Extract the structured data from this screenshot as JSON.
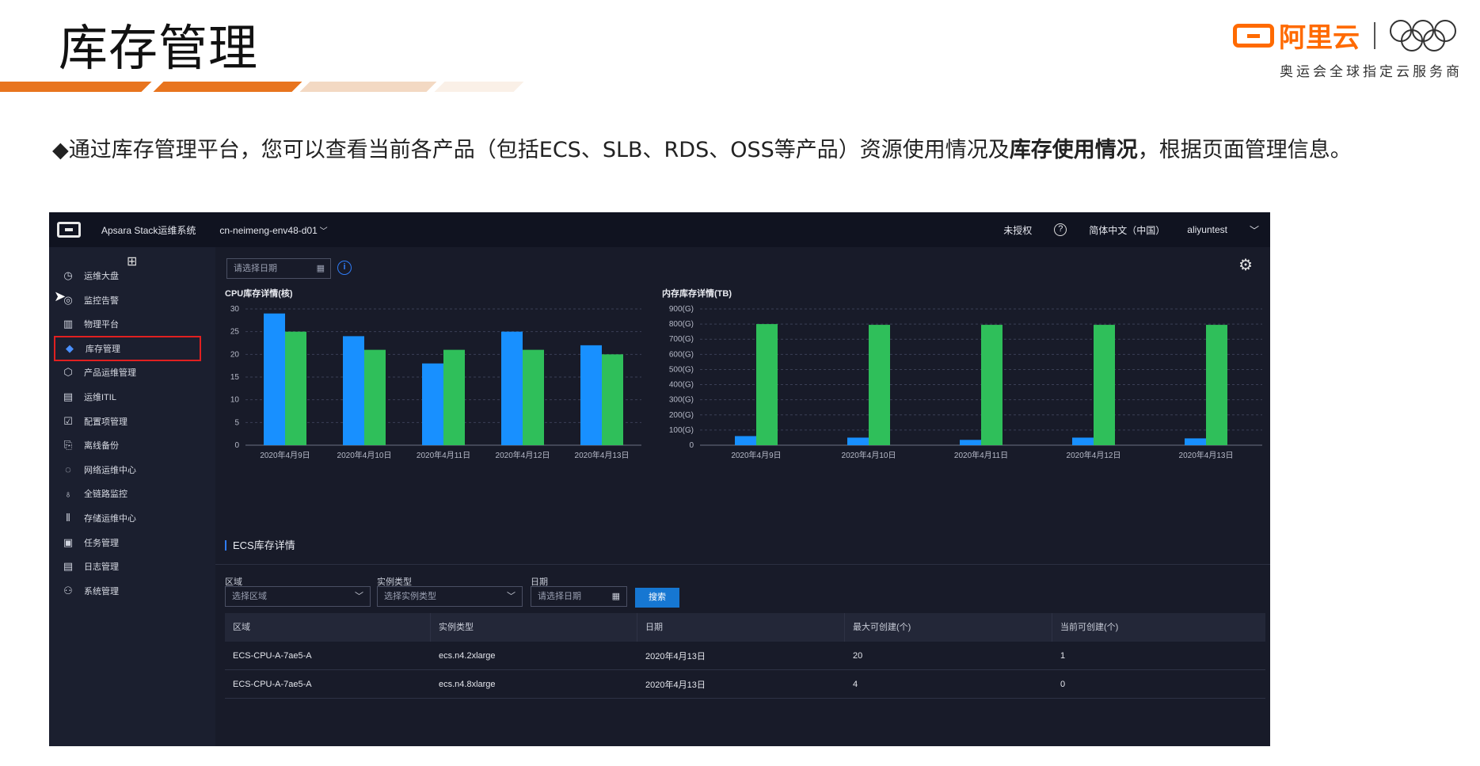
{
  "slide": {
    "title": "库存管理",
    "brand_name": "阿里云",
    "brand_sub": "奥运会全球指定云服务商",
    "bullet_prefix": "◆通过库存管理平台，您可以查看当前各产品（包括ECS、SLB、RDS、OSS等产品）资源使用情况及",
    "bullet_bold": "库存使用情况",
    "bullet_suffix": "，根据页面管理信息。"
  },
  "topbar": {
    "system_name": "Apsara Stack运维系统",
    "environment": "cn-neimeng-env48-d01",
    "unauthorized": "未授权",
    "help_icon": "?",
    "language": "简体中文（中国）",
    "user": "aliyuntest"
  },
  "sidebar": {
    "items": [
      {
        "label": "运维大盘",
        "icon": "pie-chart-icon",
        "glyph": "◷"
      },
      {
        "label": "监控告警",
        "icon": "alarm-icon",
        "glyph": "◎"
      },
      {
        "label": "物理平台",
        "icon": "bar-chart-icon",
        "glyph": "▥"
      },
      {
        "label": "库存管理",
        "icon": "stack-icon",
        "glyph": "◆"
      },
      {
        "label": "产品运维管理",
        "icon": "cube-icon",
        "glyph": "⬡"
      },
      {
        "label": "运维ITIL",
        "icon": "ticket-icon",
        "glyph": "▤"
      },
      {
        "label": "配置项管理",
        "icon": "checkbox-icon",
        "glyph": "☑"
      },
      {
        "label": "离线备份",
        "icon": "backup-icon",
        "glyph": "⎘"
      },
      {
        "label": "网络运维中心",
        "icon": "network-icon",
        "glyph": "◌"
      },
      {
        "label": "全链路监控",
        "icon": "topology-icon",
        "glyph": "♁"
      },
      {
        "label": "存储运维中心",
        "icon": "storage-icon",
        "glyph": "⦀"
      },
      {
        "label": "任务管理",
        "icon": "task-icon",
        "glyph": "▣"
      },
      {
        "label": "日志管理",
        "icon": "log-icon",
        "glyph": "▤"
      },
      {
        "label": "系统管理",
        "icon": "user-settings-icon",
        "glyph": "⚇"
      }
    ],
    "active_index": 3
  },
  "toolbar": {
    "date_placeholder": "请选择日期",
    "info_icon": "i"
  },
  "colors": {
    "series_blue": "#1890ff",
    "series_green": "#2fbf5a",
    "accent": "#1677d2",
    "highlight_box": "#e02020"
  },
  "chart_data": [
    {
      "type": "bar",
      "title": "CPU库存详情(核)",
      "categories": [
        "2020年4月9日",
        "2020年4月10日",
        "2020年4月11日",
        "2020年4月12日",
        "2020年4月13日"
      ],
      "series": [
        {
          "values": [
            29,
            24,
            18,
            25,
            22
          ]
        },
        {
          "values": [
            25,
            21,
            21,
            21,
            20
          ]
        }
      ],
      "ylim": [
        0,
        30
      ],
      "yticks": [
        "0",
        "5",
        "10",
        "15",
        "20",
        "25",
        "30"
      ],
      "grid": true
    },
    {
      "type": "bar",
      "title": "内存库存详情(TB)",
      "categories": [
        "2020年4月9日",
        "2020年4月10日",
        "2020年4月11日",
        "2020年4月12日",
        "2020年4月13日"
      ],
      "series": [
        {
          "values": [
            60,
            50,
            35,
            50,
            45
          ]
        },
        {
          "values": [
            800,
            795,
            795,
            795,
            795
          ]
        }
      ],
      "ylim": [
        0,
        900
      ],
      "yticks": [
        "0",
        "100(G)",
        "200(G)",
        "300(G)",
        "400(G)",
        "500(G)",
        "600(G)",
        "700(G)",
        "800(G)",
        "900(G)"
      ],
      "grid": true
    }
  ],
  "ecs": {
    "section_title": "ECS库存详情",
    "filters": {
      "region_label": "区域",
      "region_placeholder": "选择区域",
      "type_label": "实例类型",
      "type_placeholder": "选择实例类型",
      "date_label": "日期",
      "date_placeholder": "请选择日期",
      "search_button": "搜索"
    },
    "columns": [
      "区域",
      "实例类型",
      "日期",
      "最大可创建(个)",
      "当前可创建(个)"
    ],
    "rows": [
      [
        "ECS-CPU-A-7ae5-A",
        "ecs.n4.2xlarge",
        "2020年4月13日",
        "20",
        "1"
      ],
      [
        "ECS-CPU-A-7ae5-A",
        "ecs.n4.8xlarge",
        "2020年4月13日",
        "4",
        "0"
      ]
    ]
  }
}
